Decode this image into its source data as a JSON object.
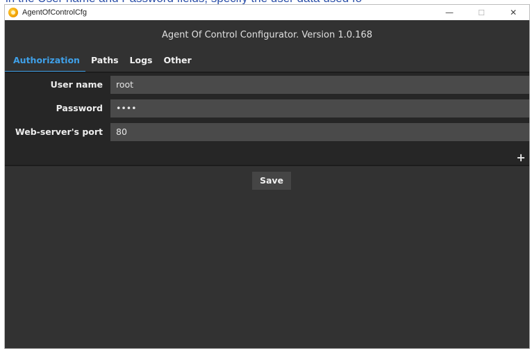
{
  "doc_fragment": "in the User name and Password fields, specify the user data used fo",
  "window": {
    "title": "AgentOfControlCfg",
    "controls": {
      "minimize": "—",
      "maximize": "☐",
      "close": "✕"
    }
  },
  "header": {
    "title": "Agent Of Control Configurator. Version 1.0.168"
  },
  "tabs": [
    {
      "label": "Authorization",
      "active": true
    },
    {
      "label": "Paths",
      "active": false
    },
    {
      "label": "Logs",
      "active": false
    },
    {
      "label": "Other",
      "active": false
    }
  ],
  "form": {
    "username": {
      "label": "User name",
      "value": "root"
    },
    "password": {
      "label": "Password",
      "value": "••••"
    },
    "port": {
      "label": "Web-server's port",
      "value": "80"
    },
    "add_label": "+"
  },
  "save_label": "Save",
  "colors": {
    "accent": "#3fa0e8",
    "background": "#323232",
    "field": "#4a4a4a"
  }
}
